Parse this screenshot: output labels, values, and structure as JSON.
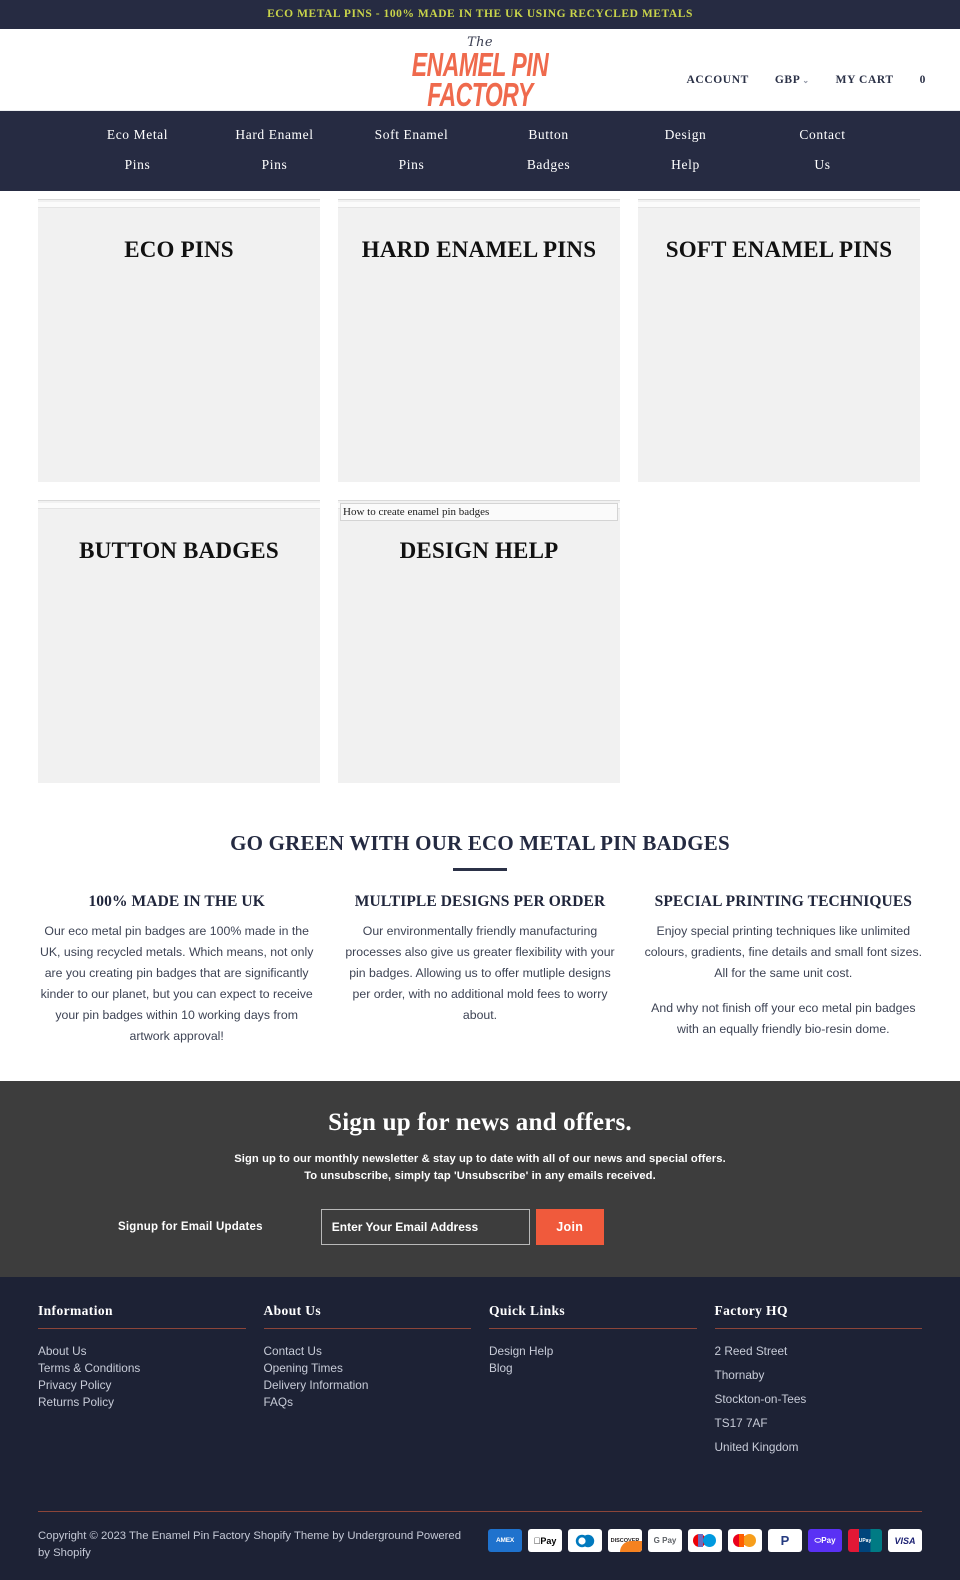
{
  "announcement": {
    "text": "ECO METAL PINS - 100% MADE IN THE UK USING RECYCLED METALS",
    "bg": "#262b42",
    "color": "#c9d44a"
  },
  "header": {
    "logo": {
      "line_the": "The",
      "line_1": "ENAMEL PIN",
      "line_2": "FACTORY",
      "color": "#ef6a4d"
    },
    "account_label": "ACCOUNT",
    "currency_label": "GBP",
    "currency_caret": "⌄",
    "cart_label": "MY CART",
    "cart_count": "0"
  },
  "nav": {
    "items": [
      {
        "line1": "Eco Metal",
        "line2": "Pins"
      },
      {
        "line1": "Hard Enamel",
        "line2": "Pins"
      },
      {
        "line1": "Soft Enamel",
        "line2": "Pins"
      },
      {
        "line1": "Button",
        "line2": "Badges"
      },
      {
        "line1": "Design",
        "line2": "Help"
      },
      {
        "line1": "Contact",
        "line2": "Us"
      }
    ]
  },
  "tiles": {
    "row1": [
      {
        "title": "ECO PINS",
        "alt": ""
      },
      {
        "title": "HARD ENAMEL PINS",
        "alt": ""
      },
      {
        "title": "SOFT ENAMEL PINS",
        "alt": ""
      }
    ],
    "row2": [
      {
        "title": "BUTTON BADGES",
        "alt": ""
      },
      {
        "title": "DESIGN HELP",
        "alt": "How to create enamel pin badges"
      }
    ]
  },
  "green": {
    "heading": "GO GREEN WITH OUR ECO METAL PIN BADGES",
    "features": [
      {
        "title": "100% MADE IN THE UK",
        "p1": "Our eco metal pin badges are 100% made in the UK, using recycled metals. Which means, not only are you creating pin badges that are significantly kinder to our planet, but you can expect to receive your pin badges within 10 working days from artwork approval!",
        "p2": ""
      },
      {
        "title": "MULTIPLE DESIGNS PER ORDER",
        "p1": "Our environmentally friendly manufacturing processes also give us greater flexibility with your pin badges. Allowing us to offer mutliple designs per order, with no additional mold fees to worry about.",
        "p2": ""
      },
      {
        "title": "SPECIAL PRINTING TECHNIQUES",
        "p1": "Enjoy special printing techniques like unlimited colours, gradients, fine details and small font sizes. All for the same unit cost.",
        "p2": "And why not finish off your eco metal pin badges with an equally friendly bio-resin dome."
      }
    ]
  },
  "newsletter": {
    "heading": "Sign up for news and offers.",
    "sub_line1": "Sign up to our monthly newsletter & stay up to date with all of our news and special offers.",
    "sub_line2": "To unsubscribe, simply tap 'Unsubscribe' in any emails received.",
    "signup_label": "Signup for Email Updates",
    "email_placeholder": "Enter Your Email Address",
    "email_value": "",
    "join_label": "Join",
    "button_color": "#f05a3c"
  },
  "footer": {
    "columns": [
      {
        "heading": "Information",
        "links": [
          "About Us",
          "Terms & Conditions",
          "Privacy Policy",
          "Returns Policy"
        ]
      },
      {
        "heading": "About Us",
        "links": [
          "Contact Us",
          "Opening Times",
          "Delivery Information",
          "FAQs"
        ]
      },
      {
        "heading": "Quick Links",
        "links": [
          "Design Help",
          "Blog"
        ]
      }
    ],
    "address": {
      "heading": "Factory HQ",
      "lines": [
        "2 Reed Street",
        "Thornaby",
        "Stockton-on-Tees",
        "TS17 7AF",
        "United Kingdom"
      ]
    },
    "copyright": "Copyright © 2023 The Enamel Pin Factory Shopify Theme by Underground Powered by Shopify",
    "payment_icons": [
      {
        "name": "amex-icon",
        "label": "AMEX"
      },
      {
        "name": "apple-pay-icon",
        "label": "Pay"
      },
      {
        "name": "diners-club-icon",
        "label": "D)"
      },
      {
        "name": "discover-icon",
        "label": "DISCOVER"
      },
      {
        "name": "google-pay-icon",
        "label": "G Pay"
      },
      {
        "name": "maestro-icon",
        "label": ""
      },
      {
        "name": "mastercard-icon",
        "label": ""
      },
      {
        "name": "paypal-icon",
        "label": "P"
      },
      {
        "name": "shop-pay-icon",
        "label": "◭Pay"
      },
      {
        "name": "unionpay-icon",
        "label": "UnionPay"
      },
      {
        "name": "visa-icon",
        "label": "VISA"
      }
    ]
  }
}
